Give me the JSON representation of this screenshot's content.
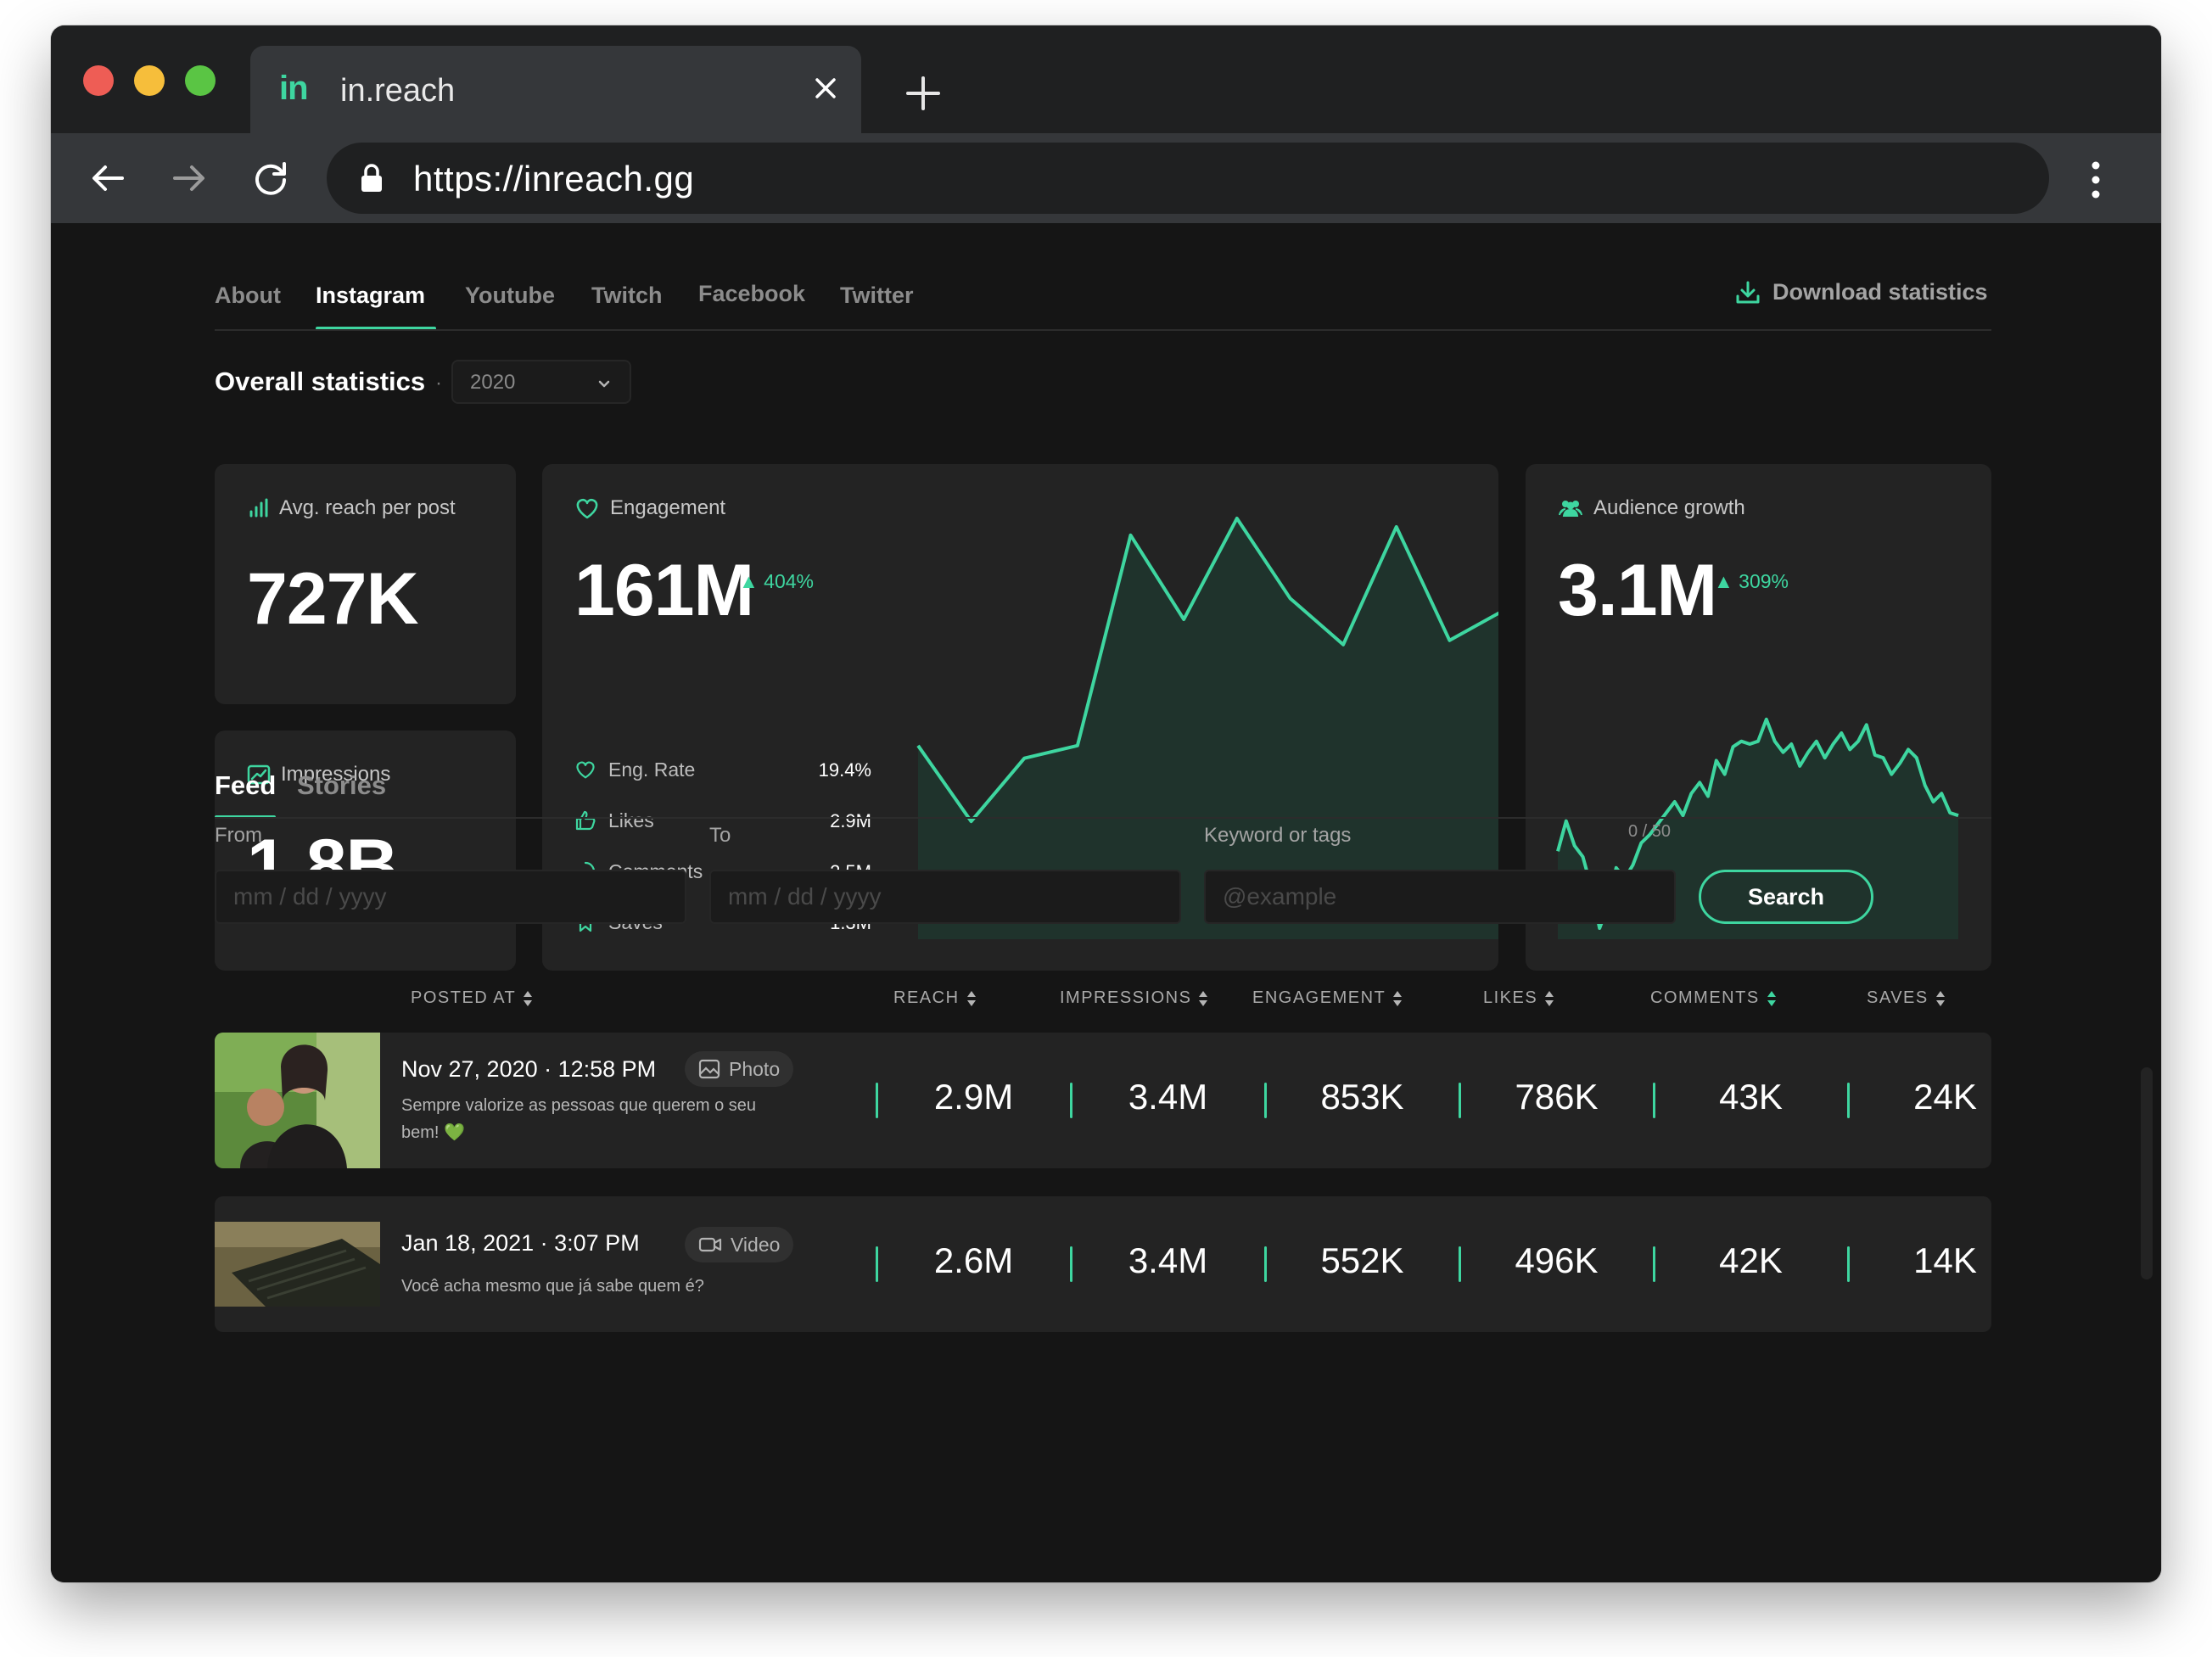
{
  "browser": {
    "tab_logo": "in",
    "tab_title": "in.reach",
    "url": "https://inreach.gg"
  },
  "profile_tabs": [
    "About",
    "Instagram",
    "Youtube",
    "Twitch",
    "Facebook",
    "Twitter"
  ],
  "active_profile_tab": "Instagram",
  "download_label": "Download statistics",
  "overall": {
    "title": "Overall statistics",
    "year": "2020"
  },
  "cards": {
    "avg_reach": {
      "label": "Avg. reach per post",
      "value": "727K"
    },
    "impressions": {
      "label": "Impressions",
      "value": "1.8B"
    },
    "engagement": {
      "label": "Engagement",
      "value": "161M",
      "delta": "404%",
      "breakdown": [
        {
          "label": "Eng. Rate",
          "value": "19.4%"
        },
        {
          "label": "Likes",
          "value": "2.9M"
        },
        {
          "label": "Comments",
          "value": "2.5M"
        },
        {
          "label": "Saves",
          "value": "1.3M"
        }
      ]
    },
    "audience": {
      "label": "Audience growth",
      "value": "3.1M",
      "delta": "309%"
    }
  },
  "chart_data": [
    {
      "type": "area",
      "x": [
        0,
        1,
        2,
        3,
        4,
        5,
        6,
        7,
        8,
        9,
        10,
        11
      ],
      "values": [
        0.46,
        0.28,
        0.43,
        0.46,
        0.96,
        0.76,
        1.0,
        0.81,
        0.7,
        0.98,
        0.71,
        0.78
      ],
      "title": "",
      "color": "#3ed6a0",
      "fill": "#1f332c"
    },
    {
      "type": "area",
      "x": [
        0,
        1,
        2,
        3,
        4,
        5,
        6,
        7,
        8,
        9,
        10,
        11,
        12,
        13,
        14,
        15,
        16,
        17,
        18,
        19,
        20,
        21,
        22,
        23,
        24,
        25,
        26,
        27,
        28,
        29,
        30,
        31,
        32,
        33,
        34,
        35,
        36,
        37,
        38,
        39,
        40,
        41,
        42,
        43,
        44,
        45,
        46,
        47,
        48
      ],
      "values": [
        0.32,
        0.43,
        0.34,
        0.3,
        0.19,
        0.04,
        0.12,
        0.26,
        0.22,
        0.27,
        0.35,
        0.38,
        0.42,
        0.46,
        0.5,
        0.45,
        0.53,
        0.57,
        0.52,
        0.65,
        0.6,
        0.7,
        0.72,
        0.71,
        0.72,
        0.8,
        0.72,
        0.68,
        0.71,
        0.63,
        0.68,
        0.72,
        0.66,
        0.71,
        0.75,
        0.69,
        0.72,
        0.78,
        0.67,
        0.66,
        0.6,
        0.64,
        0.69,
        0.66,
        0.56,
        0.5,
        0.53,
        0.46,
        0.45
      ],
      "title": "",
      "color": "#3ed6a0",
      "fill": "#1f332c"
    }
  ],
  "feed": {
    "tabs": [
      "Feed",
      "Stories"
    ],
    "filters": {
      "from_label": "From",
      "from_placeholder": "mm / dd / yyyy",
      "to_label": "To",
      "to_placeholder": "mm / dd / yyyy",
      "keyword_label": "Keyword or tags",
      "keyword_placeholder": "@example",
      "keyword_count": "0 / 50",
      "search_label": "Search"
    },
    "columns": [
      "POSTED AT",
      "REACH",
      "IMPRESSIONS",
      "ENGAGEMENT",
      "LIKES",
      "COMMENTS",
      "SAVES"
    ],
    "rows": [
      {
        "posted_at": "Nov 27, 2020 · 12:58 PM",
        "media_type": "Photo",
        "caption": "Sempre valorize as pessoas que querem o seu bem! 💚",
        "reach": "2.9M",
        "impressions": "3.4M",
        "engagement": "853K",
        "likes": "786K",
        "comments": "43K",
        "saves": "24K"
      },
      {
        "posted_at": "Jan 18, 2021 · 3:07 PM",
        "media_type": "Video",
        "caption": "Você acha mesmo que já sabe quem é?",
        "reach": "2.6M",
        "impressions": "3.4M",
        "engagement": "552K",
        "likes": "496K",
        "comments": "42K",
        "saves": "14K"
      }
    ]
  },
  "colors": {
    "accent": "#3ed6a0",
    "background": "#151515",
    "card": "#232323"
  }
}
